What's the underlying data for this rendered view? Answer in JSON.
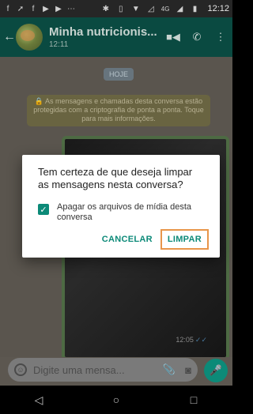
{
  "status_bar": {
    "time": "12:12",
    "network": "4G"
  },
  "header": {
    "title": "Minha nutricionis...",
    "subtitle": "12:11",
    "back_icon": "arrow-left-icon",
    "video_icon": "video-camera-icon",
    "call_icon": "phone-icon",
    "menu_icon": "more-vertical-icon"
  },
  "chat": {
    "day_label": "HOJE",
    "encryption_notice": "🔒 As mensagens e chamadas desta conversa estão protegidas com a criptografia de ponta a ponta. Toque para mais informações.",
    "media_time": "12:05"
  },
  "dialog": {
    "message": "Tem certeza de que deseja limpar as mensagens nesta conversa?",
    "checkbox_label": "Apagar os arquivos de mídia desta conversa",
    "checkbox_checked": true,
    "cancel_label": "CANCELAR",
    "clear_label": "LIMPAR"
  },
  "input_bar": {
    "placeholder": "Digite uma mensa..."
  },
  "colors": {
    "accent": "#0c8a78",
    "highlight_outline": "#e8964a",
    "appbar": "#0a4a41"
  }
}
